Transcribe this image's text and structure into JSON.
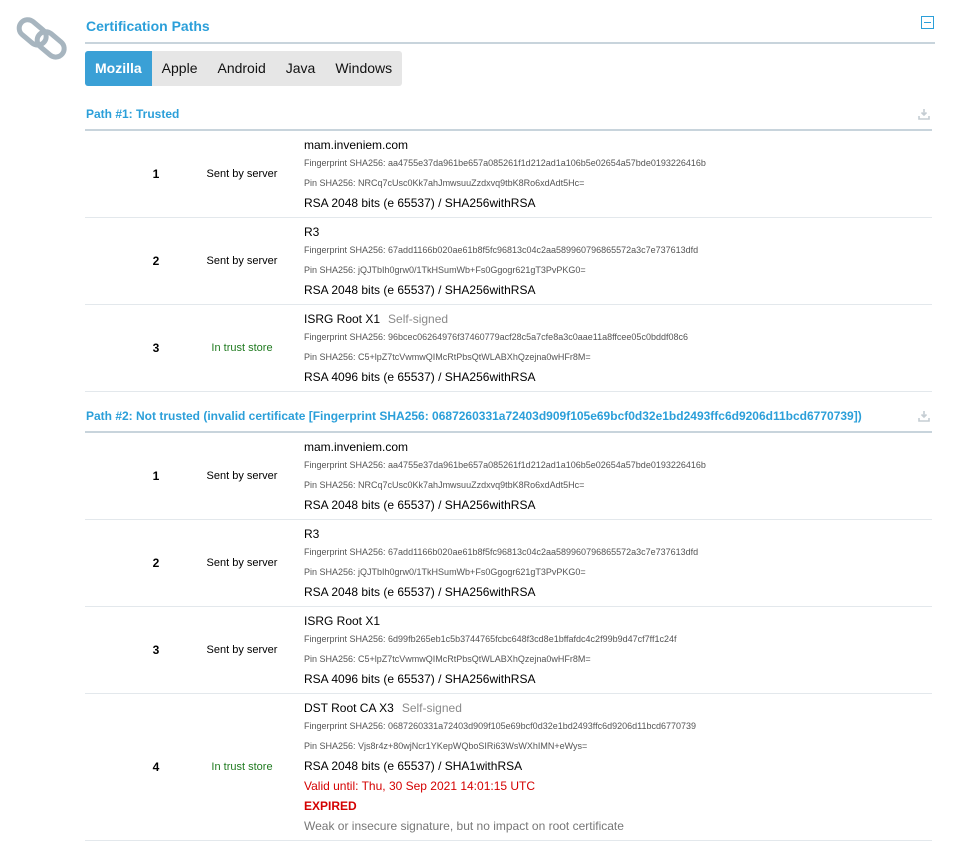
{
  "section": {
    "title": "Certification Paths",
    "tabs": [
      "Mozilla",
      "Apple",
      "Android",
      "Java",
      "Windows"
    ],
    "active_tab": "Mozilla"
  },
  "paths": [
    {
      "title": "Path #1: Trusted",
      "rows": [
        {
          "num": "1",
          "source": "Sent by server",
          "name": "mam.inveniem.com",
          "self_signed": "",
          "fingerprint": "Fingerprint SHA256: aa4755e37da961be657a085261f1d212ad1a106b5e02654a57bde0193226416b",
          "pin": "Pin SHA256: NRCq7cUsc0Kk7ahJmwsuuZzdxvq9tbK8Ro6xdAdt5Hc=",
          "key": "RSA 2048 bits (e 65537) / SHA256withRSA"
        },
        {
          "num": "2",
          "source": "Sent by server",
          "name": "R3",
          "self_signed": "",
          "fingerprint": "Fingerprint SHA256: 67add1166b020ae61b8f5fc96813c04c2aa589960796865572a3c7e737613dfd",
          "pin": "Pin SHA256: jQJTbIh0grw0/1TkHSumWb+Fs0Ggogr621gT3PvPKG0=",
          "key": "RSA 2048 bits (e 65537) / SHA256withRSA"
        },
        {
          "num": "3",
          "source": "In trust store",
          "name": "ISRG Root X1",
          "self_signed": "Self-signed",
          "fingerprint": "Fingerprint SHA256: 96bcec06264976f37460779acf28c5a7cfe8a3c0aae11a8ffcee05c0bddf08c6",
          "pin": "Pin SHA256: C5+lpZ7tcVwmwQIMcRtPbsQtWLABXhQzejna0wHFr8M=",
          "key": "RSA 4096 bits (e 65537) / SHA256withRSA"
        }
      ]
    },
    {
      "title": "Path #2: Not trusted (invalid certificate [Fingerprint SHA256: 0687260331a72403d909f105e69bcf0d32e1bd2493ffc6d9206d11bcd6770739])",
      "rows": [
        {
          "num": "1",
          "source": "Sent by server",
          "name": "mam.inveniem.com",
          "self_signed": "",
          "fingerprint": "Fingerprint SHA256: aa4755e37da961be657a085261f1d212ad1a106b5e02654a57bde0193226416b",
          "pin": "Pin SHA256: NRCq7cUsc0Kk7ahJmwsuuZzdxvq9tbK8Ro6xdAdt5Hc=",
          "key": "RSA 2048 bits (e 65537) / SHA256withRSA"
        },
        {
          "num": "2",
          "source": "Sent by server",
          "name": "R3",
          "self_signed": "",
          "fingerprint": "Fingerprint SHA256: 67add1166b020ae61b8f5fc96813c04c2aa589960796865572a3c7e737613dfd",
          "pin": "Pin SHA256: jQJTbIh0grw0/1TkHSumWb+Fs0Ggogr621gT3PvPKG0=",
          "key": "RSA 2048 bits (e 65537) / SHA256withRSA"
        },
        {
          "num": "3",
          "source": "Sent by server",
          "name": "ISRG Root X1",
          "self_signed": "",
          "fingerprint": "Fingerprint SHA256: 6d99fb265eb1c5b3744765fcbc648f3cd8e1bffafdc4c2f99b9d47cf7ff1c24f",
          "pin": "Pin SHA256: C5+lpZ7tcVwmwQIMcRtPbsQtWLABXhQzejna0wHFr8M=",
          "key": "RSA 4096 bits (e 65537) / SHA256withRSA"
        },
        {
          "num": "4",
          "source": "In trust store",
          "name": "DST Root CA X3",
          "self_signed": "Self-signed",
          "fingerprint": "Fingerprint SHA256: 0687260331a72403d909f105e69bcf0d32e1bd2493ffc6d9206d11bcd6770739",
          "pin": "Pin SHA256: Vjs8r4z+80wjNcr1YKepWQboSIRi63WsWXhIMN+eWys=",
          "key": "RSA 2048 bits (e 65537) / SHA1withRSA",
          "valid_until": "Valid until: Thu, 30 Sep 2021 14:01:15 UTC",
          "expired": "EXPIRED",
          "note": "Weak or insecure signature, but no impact on root certificate"
        }
      ]
    }
  ],
  "colors": {
    "accent": "#2b9fd9",
    "trust": "#1f7a1f",
    "expired": "#d40000"
  }
}
